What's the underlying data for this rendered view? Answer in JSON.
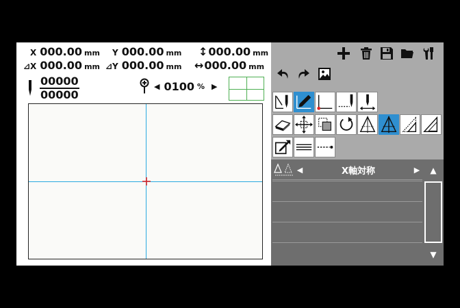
{
  "coords": {
    "x": {
      "label": "X",
      "value": "000.00",
      "unit": "mm"
    },
    "y": {
      "label": "Y",
      "value": "000.00",
      "unit": "mm"
    },
    "h": {
      "value": "000.00",
      "unit": "mm"
    },
    "dx": {
      "label": "⊿X",
      "value": "000.00",
      "unit": "mm"
    },
    "dy": {
      "label": "⊿Y",
      "value": "000.00",
      "unit": "mm"
    },
    "w": {
      "value": "000.00",
      "unit": "mm"
    }
  },
  "counter": {
    "numerator": "00000",
    "denominator": "00000"
  },
  "zoom": {
    "value": "0100",
    "unit": "%"
  },
  "list": {
    "title": "X軸対称",
    "rows": [
      "",
      "",
      ""
    ]
  },
  "colors": {
    "accent": "#2f8fd0",
    "guide": "#29a9e0",
    "origin": "#e02020",
    "quad": "#4caf50",
    "panel": "#aaaaaa",
    "list_bg": "#6e6e6e"
  },
  "icons": {
    "toolbar": [
      "plus-icon",
      "trash-icon",
      "save-icon",
      "folder-icon",
      "tools-icon"
    ],
    "edit": [
      "undo-icon",
      "redo-icon",
      "image-icon"
    ],
    "row1": [
      "needle-line-icon",
      "pen-edit-icon",
      "corner-point-icon",
      "dashed-needle-icon",
      "needle-move-icon"
    ],
    "row2": [
      "eraser-icon",
      "move-arrows-icon",
      "copy-icon",
      "rotate-icon",
      "mirror-y-icon",
      "mirror-x-icon",
      "scale-triangle-icon",
      "triangle-icon"
    ],
    "row3": [
      "edit-box-icon",
      "parallel-lines-icon",
      "dashed-end-icon"
    ]
  }
}
